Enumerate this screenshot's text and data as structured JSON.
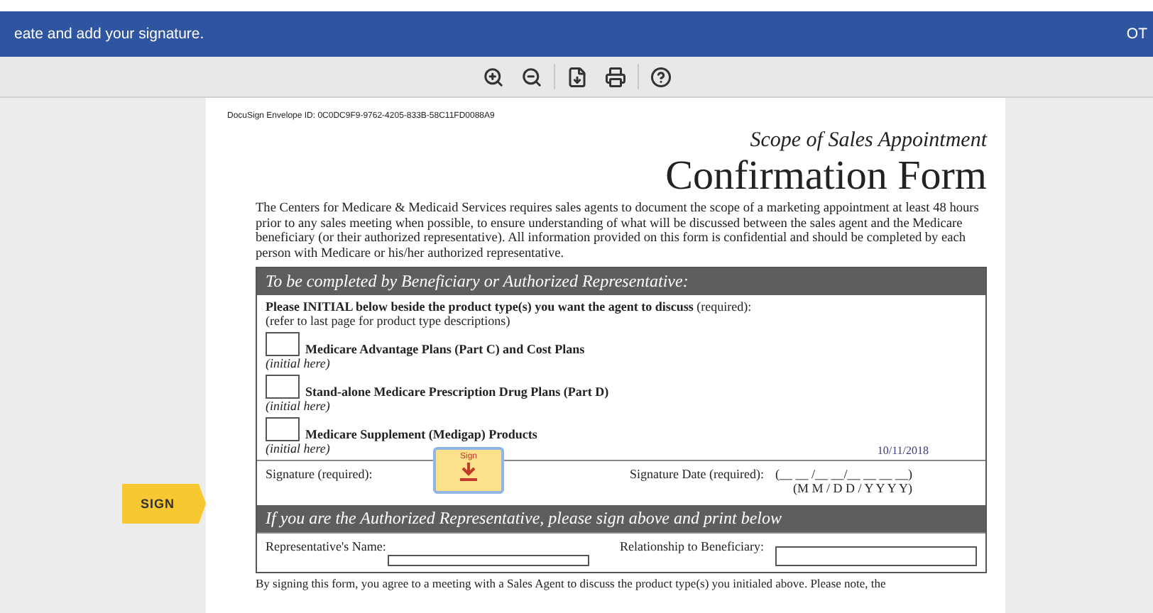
{
  "banner": {
    "message": "eate and add your signature.",
    "action": "OT"
  },
  "toolbar": {
    "buttons": [
      {
        "kind": "zoom-in"
      },
      {
        "kind": "zoom-out"
      },
      {
        "kind": "download"
      },
      {
        "kind": "print"
      },
      {
        "kind": "help"
      }
    ]
  },
  "sign_tag": {
    "label": "SIGN"
  },
  "document": {
    "envelope_id": "DocuSign Envelope ID: 0C0DC9F9-9762-4205-833B-58C11FD0088A9",
    "subtitle": "Scope of Sales Appointment",
    "title": "Confirmation Form",
    "intro": "The Centers for Medicare & Medicaid Services requires sales agents to document the scope of a marketing appointment at least 48 hours prior to any sales meeting when possible, to ensure understanding of what will be discussed between the sales agent and the Medicare beneficiary (or their authorized representative). All information provided on this form is confidential and should be completed by each person with Medicare or his/her authorized representative.",
    "section1": "To be completed by Beneficiary or Authorized Representative:",
    "instruction": "**Please INITIAL below beside the product type(s) you want the agent to discuss** (required):",
    "instruction_note": "(refer to last page for product type descriptions)",
    "products": [
      {
        "label": "Medicare Advantage Plans (Part C) and Cost Plans",
        "hint": "(initial here)"
      },
      {
        "label": "Stand-alone Medicare Prescription Drug Plans (Part D)",
        "hint": "(initial here)"
      },
      {
        "label": "Medicare Supplement (Medigap) Products",
        "hint": "(initial here)"
      }
    ],
    "signature_label": "Signature (required):",
    "sign_button": "Sign",
    "date_value": "10/11/2018",
    "date_label": "Signature Date (required):",
    "date_blank": "(__ __ /__ __/__ __ __ __)",
    "date_format": "(M M / D D / Y Y Y Y)",
    "section2": "If you are the Authorized Representative, please sign above and print below",
    "rep_name_label": "Representative's Name:",
    "relationship_label": "Relationship to Beneficiary:",
    "footer": "By signing this form, you agree to a meeting with a Sales Agent to discuss the product type(s) you initialed above. Please note, the"
  }
}
